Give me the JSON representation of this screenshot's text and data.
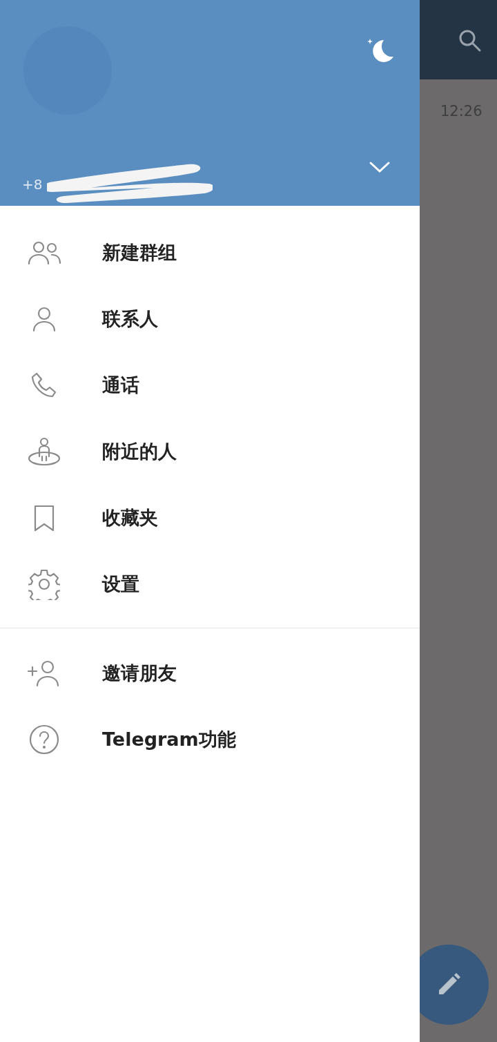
{
  "drawer": {
    "header": {
      "phone": "+8"
    },
    "menu": [
      {
        "label": "新建群组"
      },
      {
        "label": "联系人"
      },
      {
        "label": "通话"
      },
      {
        "label": "附近的人"
      },
      {
        "label": "收藏夹"
      },
      {
        "label": "设置"
      }
    ],
    "secondary_menu": [
      {
        "label": "邀请朋友"
      },
      {
        "label": "Telegram功能"
      }
    ]
  },
  "background_chat_list": {
    "time": "12:26"
  }
}
